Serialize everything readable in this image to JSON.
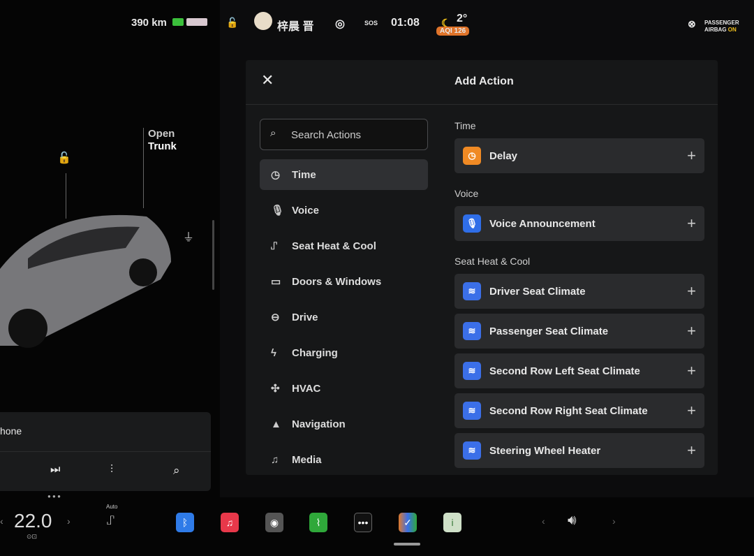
{
  "status": {
    "range": "390 km",
    "user": "梓晨 晋",
    "sos": "SOS",
    "time": "01:08",
    "temp": "2°",
    "aqi": "AQI 126",
    "airbag_line1": "PASSENGER",
    "airbag_line2": "AIRBAG",
    "airbag_state": "ON"
  },
  "car": {
    "open_trunk_1": "Open",
    "open_trunk_2": "Trunk"
  },
  "media": {
    "source": "hone"
  },
  "panel": {
    "title": "Add Action",
    "search_placeholder": "Search Actions"
  },
  "categories": [
    {
      "label": "Time",
      "icon": "clock-icon"
    },
    {
      "label": "Voice",
      "icon": "mic-icon"
    },
    {
      "label": "Seat Heat & Cool",
      "icon": "seat-heat-icon"
    },
    {
      "label": "Doors & Windows",
      "icon": "door-icon"
    },
    {
      "label": "Drive",
      "icon": "steering-wheel-icon"
    },
    {
      "label": "Charging",
      "icon": "bolt-icon"
    },
    {
      "label": "HVAC",
      "icon": "fan-icon"
    },
    {
      "label": "Navigation",
      "icon": "navigation-icon"
    },
    {
      "label": "Media",
      "icon": "music-icon"
    }
  ],
  "sections": [
    {
      "title": "Time",
      "items": [
        {
          "label": "Delay",
          "color": "#f08a24",
          "icon": "timer-icon"
        }
      ]
    },
    {
      "title": "Voice",
      "items": [
        {
          "label": "Voice Announcement",
          "color": "#2f6ee8",
          "icon": "mic-icon"
        }
      ]
    },
    {
      "title": "Seat Heat & Cool",
      "items": [
        {
          "label": "Driver Seat Climate",
          "color": "#3b6fe8"
        },
        {
          "label": "Passenger Seat Climate",
          "color": "#3b6fe8"
        },
        {
          "label": "Second Row Left Seat Climate",
          "color": "#3b6fe8"
        },
        {
          "label": "Second Row Right Seat Climate",
          "color": "#3b6fe8"
        },
        {
          "label": "Steering Wheel Heater",
          "color": "#3b6fe8"
        }
      ]
    }
  ],
  "bottom": {
    "cabin_temp": "22.0",
    "seat_mode": "Auto"
  }
}
